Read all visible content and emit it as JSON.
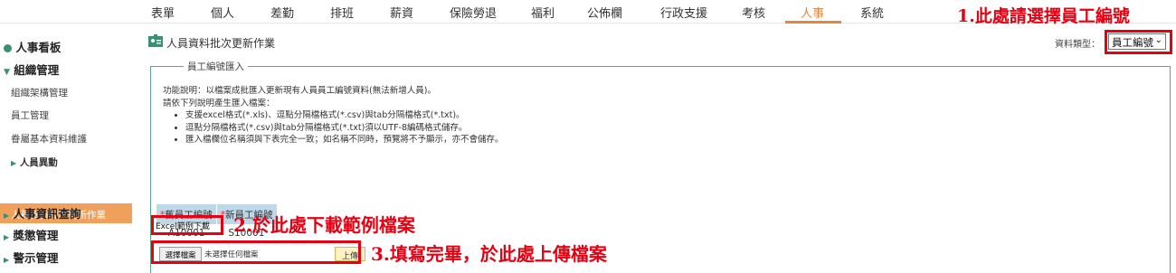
{
  "topnav": {
    "items": [
      "表單",
      "個人",
      "差勤",
      "排班",
      "薪資",
      "保險勞退",
      "福利",
      "公佈欄",
      "行政支援",
      "考核",
      "人事",
      "系統"
    ],
    "active_index": 10,
    "active_color": "#e8853c"
  },
  "sidebar": {
    "items": [
      {
        "label": "人事看板",
        "icon": "pie-chart-icon"
      },
      {
        "label": "組織管理",
        "icon": "caret-down-icon"
      },
      {
        "label": "組織架構管理"
      },
      {
        "label": "員工管理"
      },
      {
        "label": "眷屬基本資料維護"
      },
      {
        "label": "人員異動",
        "icon": "caret-right-icon"
      },
      {
        "label": "人員資料批次更新作業"
      },
      {
        "label": "人事資訊查詢",
        "icon": "caret-right-icon"
      },
      {
        "label": "獎懲管理",
        "icon": "caret-right-icon"
      },
      {
        "label": "警示管理",
        "icon": "caret-right-icon"
      }
    ],
    "active_color": "#f0a05a"
  },
  "page": {
    "icon": "id-card-icon",
    "title": "人員資料批次更新作業",
    "data_type_label": "資料類型：",
    "data_type_value": "員工編號"
  },
  "panel": {
    "legend": "員工編號匯入",
    "desc_line1": "功能說明：以檔案成批匯入更新現有人員員工編號資料(無法新增人員)。",
    "desc_line2": "請依下列說明產生匯入檔案：",
    "bullets": [
      "支援excel格式(*.xls)、逗點分隔檔格式(*.csv)與tab分隔檔格式(*.txt)。",
      "逗點分隔檔格式(*.csv)與tab分隔檔格式(*.txt)須以UTF-8編碼格式儲存。",
      "匯入檔欄位名稱須與下表完全一致；如名稱不同時，預覽將不予顯示，亦不會儲存。"
    ],
    "table": {
      "headers": [
        "舊員工編號",
        "新員工編號"
      ],
      "required_mark": "*",
      "row": [
        "A10001",
        "S10001"
      ]
    },
    "download_label": "Excel範例下載",
    "choose_file_label": "選擇檔案",
    "no_file_label": "未選擇任何檔案",
    "upload_label": "上傳"
  },
  "annotations": {
    "a1": "1.此處請選擇員工編號",
    "a2": "2.於此處下載範例檔案",
    "a3": "3.填寫完畢，於此處上傳檔案",
    "color": "#e60012"
  }
}
